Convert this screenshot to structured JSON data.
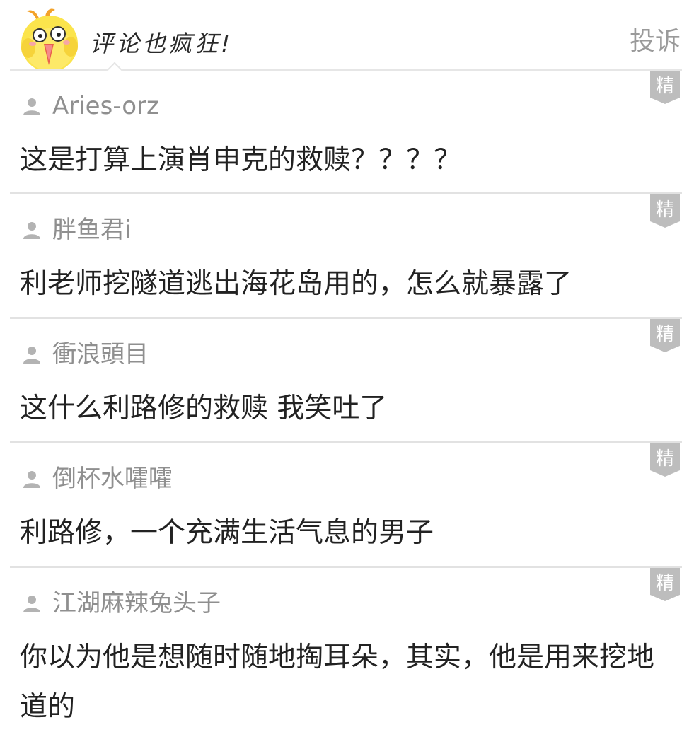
{
  "header": {
    "title": "评论也疯狂!",
    "report_label": "投诉",
    "mascot_icon": "chick-mascot-icon"
  },
  "badge_label": "精",
  "comments": [
    {
      "user": "Aries-orz",
      "text": "这是打算上演肖申克的救赎？？？？"
    },
    {
      "user": "胖鱼君i",
      "text": "利老师挖隧道逃出海花岛用的，怎么就暴露了"
    },
    {
      "user": "衝浪頭目",
      "text": "这什么利路修的救赎 我笑吐了"
    },
    {
      "user": "倒杯水嚯嚯",
      "text": "利路修，一个充满生活气息的男子"
    },
    {
      "user": "江湖麻辣兔头子",
      "text": "你以为他是想随时随地掏耳朵，其实，他是用来挖地道的"
    }
  ],
  "colors": {
    "username": "#8f8f8f",
    "badge": "#bdbdbd",
    "divider": "#e2e2e2",
    "report": "#9a9a9a"
  }
}
